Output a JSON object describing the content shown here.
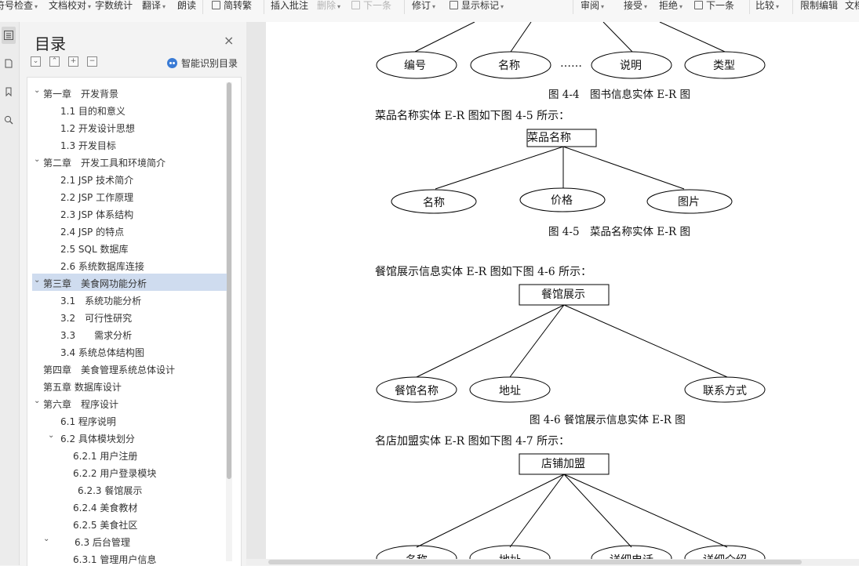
{
  "toolbar": {
    "items": [
      {
        "label": "符号检查",
        "caret": "▾"
      },
      {
        "label": "文档校对",
        "caret": "▾"
      },
      {
        "label": "字数统计"
      },
      {
        "label": "翻译",
        "caret": "▾"
      },
      {
        "label": "朗读"
      },
      {
        "label": "简转繁"
      },
      {
        "label": "插入批注"
      },
      {
        "label": "删除",
        "caret": "▾"
      },
      {
        "label": "下一条"
      },
      {
        "label": "修订",
        "caret": "▾"
      },
      {
        "label": "显示标记",
        "caret": "▾"
      },
      {
        "label": "审阅",
        "caret": "▾"
      },
      {
        "label": "接受",
        "caret": "▾"
      },
      {
        "label": "拒绝",
        "caret": "▾"
      },
      {
        "label": "下一条"
      },
      {
        "label": "比较",
        "caret": "▾"
      },
      {
        "label": "限制编辑"
      },
      {
        "label": "文档"
      }
    ]
  },
  "toc": {
    "title": "目录",
    "close": "×",
    "controls": [
      "⌄",
      "⌃",
      "+",
      "−"
    ],
    "smart_label": "智能识别目录",
    "items": [
      {
        "label": "第一章　开发背景",
        "arrow": "⌄"
      },
      {
        "label": "1.1  目的和意义"
      },
      {
        "label": "1.2  开发设计思想"
      },
      {
        "label": "1.3  开发目标"
      },
      {
        "label": "第二章　开发工具和环境简介",
        "arrow": "⌄"
      },
      {
        "label": "2.1 JSP 技术简介"
      },
      {
        "label": "2.2 JSP 工作原理"
      },
      {
        "label": "2.3 JSP 体系结构"
      },
      {
        "label": "2.4 JSP 的特点"
      },
      {
        "label": "2.5 SQL  数据库"
      },
      {
        "label": "2.6  系统数据库连接"
      },
      {
        "label": "第三章　美食网功能分析",
        "arrow": "⌄",
        "selected": true
      },
      {
        "label": "3.1　系统功能分析"
      },
      {
        "label": "3.2　可行性研究"
      },
      {
        "label": "3.3　　需求分析"
      },
      {
        "label": "3.4  系统总体结构图"
      },
      {
        "label": "第四章　美食管理系统总体设计"
      },
      {
        "label": "第五章  数据库设计"
      },
      {
        "label": "第六章　程序设计",
        "arrow": "⌄"
      },
      {
        "label": "6.1  程序说明"
      },
      {
        "label": "6.2  具体模块划分",
        "arrow": "⌄"
      },
      {
        "label": "6.2.1 用户注册"
      },
      {
        "label": "6.2.2 用户登录模块"
      },
      {
        "label": "6.2.3 餐馆展示"
      },
      {
        "label": "6.2.4 美食教材"
      },
      {
        "label": "6.2.5 美食社区"
      },
      {
        "label": "6.3 后台管理",
        "arrow": "⌄"
      },
      {
        "label": "6.3.1 管理用户信息"
      }
    ]
  },
  "document": {
    "diagram1": {
      "attrs": [
        "编号",
        "名称",
        "……",
        "说明",
        "类型"
      ],
      "caption": "图 4-4　图书信息实体 E-R 图"
    },
    "para2": "菜品名称实体 E-R 图如下图 4-5 所示：",
    "diagram2": {
      "entity": "菜品名称",
      "attrs": [
        "名称",
        "价格",
        "图片"
      ],
      "caption": "图 4-5　菜品名称实体 E-R 图"
    },
    "para3": "餐馆展示信息实体 E-R 图如下图 4-6 所示：",
    "diagram3": {
      "entity": "餐馆展示",
      "attrs": [
        "餐馆名称",
        "地址",
        "联系方式"
      ],
      "caption": "图 4-6  餐馆展示信息实体 E-R 图"
    },
    "para4": "名店加盟实体 E-R 图如下图 4-7 所示：",
    "diagram4": {
      "entity": "店铺加盟",
      "attrs": [
        "名称",
        "地址",
        "……",
        "详细电话",
        "详细介绍"
      ]
    }
  }
}
